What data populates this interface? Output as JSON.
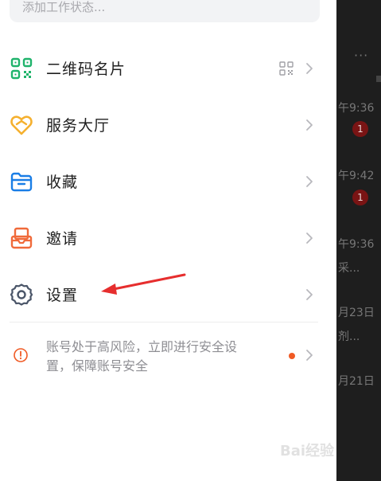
{
  "status_input": {
    "placeholder": "添加工作状态..."
  },
  "menu": [
    {
      "label": "二维码名片",
      "icon": "qr-code-icon",
      "color": "#1fb36b"
    },
    {
      "label": "服务大厅",
      "icon": "service-hall-heart-icon",
      "color": "#f5b02e"
    },
    {
      "label": "收藏",
      "icon": "folder-icon",
      "color": "#1a7ee6"
    },
    {
      "label": "邀请",
      "icon": "invite-inbox-icon",
      "color": "#f06a3a"
    },
    {
      "label": "设置",
      "icon": "gear-icon",
      "color": "#4a5568"
    }
  ],
  "security_alert": {
    "text": "账号处于高风险，立即进行安全设置，保障账号安全",
    "icon": "warning-circle-icon",
    "dot_color": "#f05a24"
  },
  "annotation": {
    "arrow_color": "#e62e2e",
    "target": "设置"
  },
  "background_chat": {
    "times": [
      "午9:36",
      "午9:42",
      "午9:36",
      "月23日",
      "月21日"
    ],
    "badges": [
      "1",
      "1"
    ],
    "snippets": [
      "采...",
      "剂..."
    ]
  },
  "watermark": "Bai经验"
}
